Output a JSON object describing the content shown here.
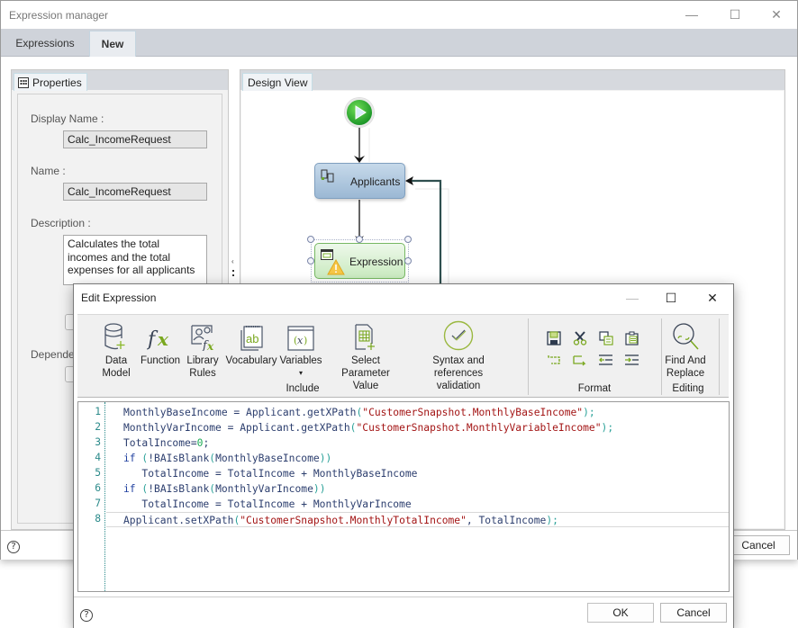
{
  "main_window": {
    "title": "Expression manager",
    "controls": {
      "minimize": "—",
      "maximize": "☐",
      "close": "✕"
    },
    "tabs": [
      {
        "label": "Expressions",
        "active": false
      },
      {
        "label": "New",
        "active": true
      }
    ],
    "properties_panel": {
      "tab_label": "Properties",
      "display_name_label": "Display Name :",
      "display_name_value": "Calc_IncomeRequest",
      "name_label": "Name :",
      "name_value": "Calc_IncomeRequest",
      "description_label": "Description :",
      "description_value": "Calculates the total incomes and the total expenses for all applicants",
      "dependencies_label": "Dependen"
    },
    "design_panel": {
      "tab_label": "Design View",
      "nodes": [
        {
          "type": "start",
          "label": ""
        },
        {
          "type": "loop",
          "label": "Applicants"
        },
        {
          "type": "expression",
          "label": "Expression",
          "warning": true
        }
      ]
    },
    "cancel_label": "Cancel",
    "help_label": "?"
  },
  "edit_dialog": {
    "title": "Edit Expression",
    "controls": {
      "minimize": "—",
      "maximize": "☐",
      "close": "✕"
    },
    "ribbon": {
      "include_group": {
        "label": "Include",
        "buttons": [
          {
            "icon": "database-add-icon",
            "line1": "Data",
            "line2": "Model"
          },
          {
            "icon": "function-icon",
            "line1": "Function",
            "line2": ""
          },
          {
            "icon": "library-rules-icon",
            "line1": "Library",
            "line2": "Rules"
          },
          {
            "icon": "vocabulary-icon",
            "line1": "Vocabulary",
            "line2": ""
          },
          {
            "icon": "variables-icon",
            "line1": "Variables",
            "line2": "▾"
          },
          {
            "icon": "select-parameter-icon",
            "line1": "Select Parameter",
            "line2": "Value"
          },
          {
            "icon": "validation-check-icon",
            "line1": "Syntax and references",
            "line2": "validation"
          }
        ]
      },
      "format_group": {
        "label": "Format",
        "buttons": [
          "save-icon",
          "cut-icon",
          "copy-icon",
          "paste-icon",
          "undo-icon",
          "redo-icon",
          "outdent-icon",
          "indent-icon"
        ]
      },
      "editing_group": {
        "label": "Editing",
        "buttons": [
          {
            "icon": "find-replace-icon",
            "line1": "Find And",
            "line2": "Replace"
          }
        ]
      }
    },
    "code_lines": [
      {
        "n": "1",
        "parts": [
          [
            "",
            "MonthlyBaseIncome = Applicant.getXPath"
          ],
          [
            "pn",
            "("
          ],
          [
            "str",
            "\"CustomerSnapshot.MonthlyBaseIncome\""
          ],
          [
            "pn",
            ");"
          ]
        ]
      },
      {
        "n": "2",
        "parts": [
          [
            "",
            "MonthlyVarIncome = Applicant.getXPath"
          ],
          [
            "pn",
            "("
          ],
          [
            "str",
            "\"CustomerSnapshot.MonthlyVariableIncome\""
          ],
          [
            "pn",
            ");"
          ]
        ]
      },
      {
        "n": "3",
        "parts": [
          [
            "",
            "TotalIncome="
          ],
          [
            "num",
            "0"
          ],
          [
            "",
            ";"
          ]
        ]
      },
      {
        "n": "4",
        "parts": [
          [
            "kw",
            "if"
          ],
          [
            "",
            " "
          ],
          [
            "pn",
            "("
          ],
          [
            "",
            "!BAIsBlank"
          ],
          [
            "pn",
            "("
          ],
          [
            "",
            "MonthlyBaseIncome"
          ],
          [
            "pn",
            "))"
          ]
        ]
      },
      {
        "n": "5",
        "parts": [
          [
            "",
            "   TotalIncome = TotalIncome + MonthlyBaseIncome"
          ]
        ]
      },
      {
        "n": "6",
        "parts": [
          [
            "kw",
            "if"
          ],
          [
            "",
            " "
          ],
          [
            "pn",
            "("
          ],
          [
            "",
            "!BAIsBlank"
          ],
          [
            "pn",
            "("
          ],
          [
            "",
            "MonthlyVarIncome"
          ],
          [
            "pn",
            "))"
          ]
        ]
      },
      {
        "n": "7",
        "parts": [
          [
            "",
            "   TotalIncome = TotalIncome + MonthlyVarIncome"
          ]
        ]
      },
      {
        "n": "8",
        "parts": [
          [
            "",
            "Applicant.setXPath"
          ],
          [
            "pn",
            "("
          ],
          [
            "str",
            "\"CustomerSnapshot.MonthlyTotalIncome\""
          ],
          [
            "",
            ", TotalIncome"
          ],
          [
            "pn",
            ");"
          ]
        ]
      }
    ],
    "current_line": 8,
    "ok_label": "OK",
    "cancel_label": "Cancel",
    "help_label": "?"
  }
}
